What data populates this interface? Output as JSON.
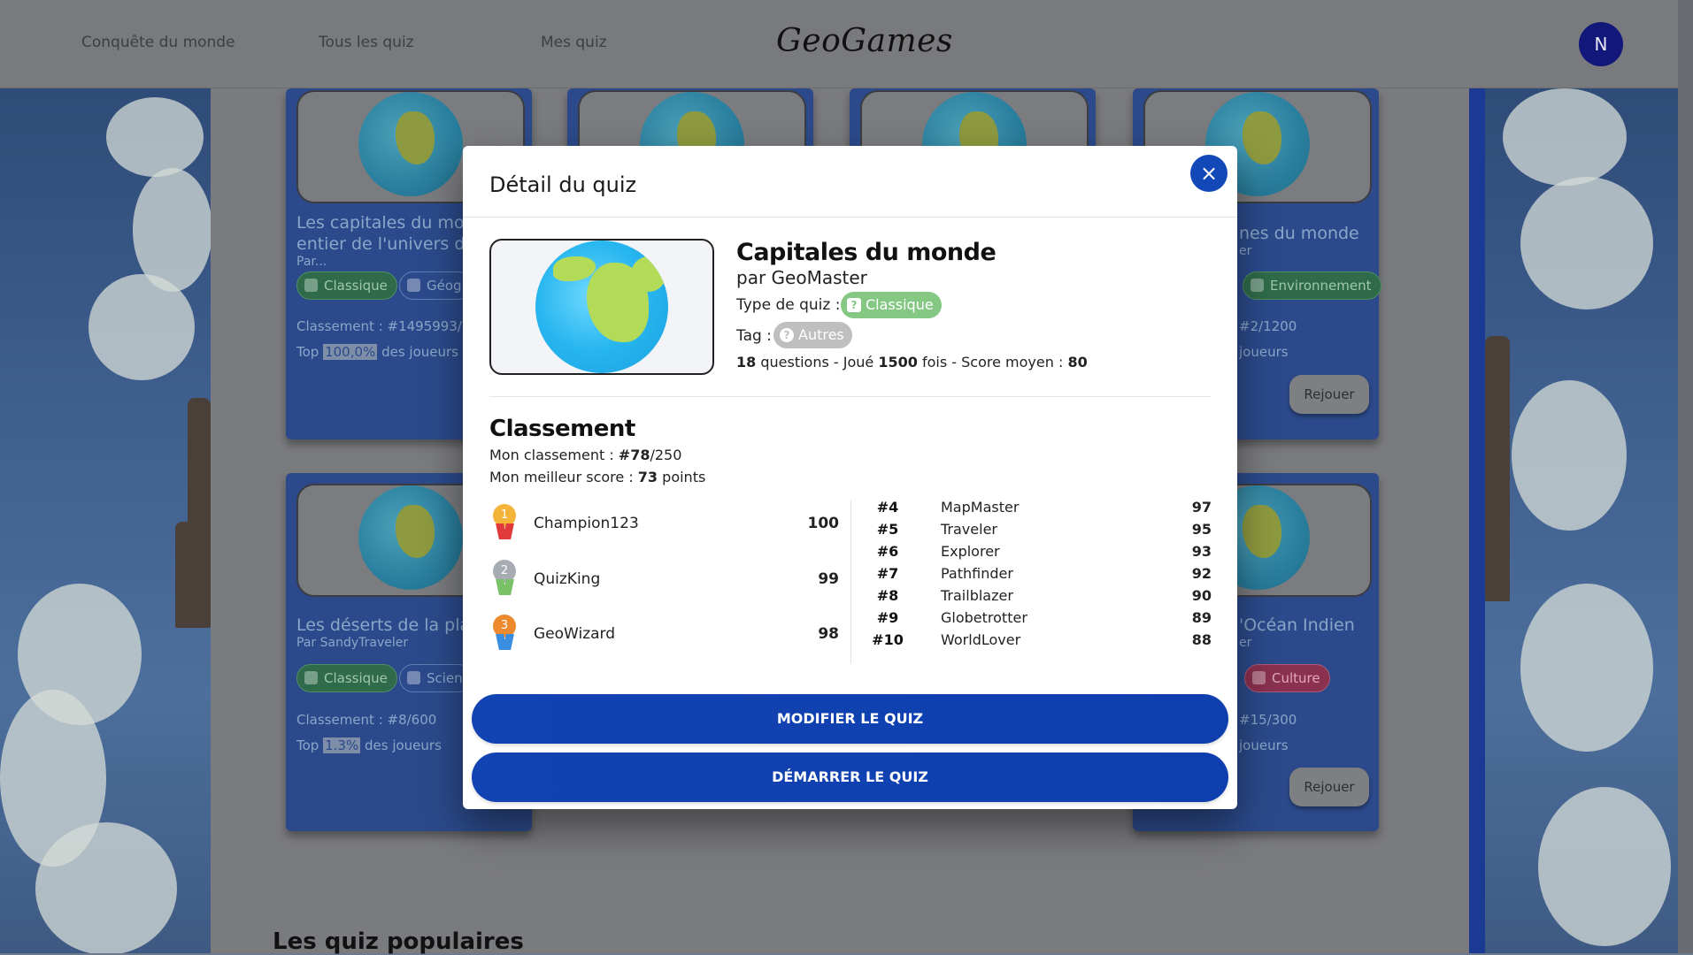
{
  "header": {
    "nav": [
      "Conquête du monde",
      "Tous les quiz",
      "Mes quiz"
    ],
    "logo": "GeoGames",
    "avatar_initial": "N"
  },
  "cards": [
    {
      "title_line1": "Les capitales du mo",
      "title_line2": "entier de l'univers de",
      "author": "Par...",
      "tag1": "Classique",
      "tag2": "Géog",
      "rank": "Classement : #1495993/",
      "top_prefix": "Top",
      "top_value": "100,0%",
      "top_suffix": "des joueurs"
    },
    {
      "title_line1": "nes du monde",
      "author": "er",
      "tag2": "Environnement",
      "rank": "#2/1200",
      "top_suffix": "joueurs",
      "button": "Rejouer"
    },
    {
      "title_line1": "Les déserts de la pla",
      "author": "Par SandyTraveler",
      "tag1": "Classique",
      "tag2": "Scien",
      "rank": "Classement : #8/600",
      "top_prefix": "Top",
      "top_value": "1.3%",
      "top_suffix": "des joueurs"
    },
    {
      "title_line1": "'Océan Indien",
      "author": "er",
      "tag2": "Culture",
      "rank": "#15/300",
      "top_suffix": "joueurs",
      "button": "Rejouer"
    }
  ],
  "section_title": "Les quiz populaires",
  "modal": {
    "title": "Détail du quiz",
    "close_icon": "×",
    "quiz_name": "Capitales du monde",
    "author": "par GeoMaster",
    "type_label": "Type de quiz :",
    "type_value": "Classique",
    "type_icon_glyph": "?",
    "tag_label": "Tag :",
    "tag_value": "Autres",
    "tag_icon_glyph": "?",
    "questions": "18",
    "questions_label": "questions -",
    "played_label": "Joué",
    "played": "1500",
    "played_suffix": "fois - Score moyen :",
    "average": "80",
    "ranking_title": "Classement",
    "my_rank_label": "Mon classement :",
    "my_rank_prefix": "#",
    "my_rank": "78",
    "my_rank_total": "/250",
    "best_label": "Mon meilleur score :",
    "best": "73",
    "best_suffix": "points",
    "podium": [
      {
        "medal": "1",
        "name": "Champion123",
        "score": "100",
        "disc_color": "#f4b43a",
        "ribbon_color": "#e03a3a"
      },
      {
        "medal": "2",
        "name": "QuizKing",
        "score": "99",
        "disc_color": "#a7acb3",
        "ribbon_color": "#7ac268"
      },
      {
        "medal": "3",
        "name": "GeoWizard",
        "score": "98",
        "disc_color": "#ee8a2e",
        "ribbon_color": "#3a8ee0"
      }
    ],
    "others": [
      {
        "rank": "#4",
        "name": "MapMaster",
        "score": "97"
      },
      {
        "rank": "#5",
        "name": "Traveler",
        "score": "95"
      },
      {
        "rank": "#6",
        "name": "Explorer",
        "score": "93"
      },
      {
        "rank": "#7",
        "name": "Pathfinder",
        "score": "92"
      },
      {
        "rank": "#8",
        "name": "Trailblazer",
        "score": "90"
      },
      {
        "rank": "#9",
        "name": "Globetrotter",
        "score": "89"
      },
      {
        "rank": "#10",
        "name": "WorldLover",
        "score": "88"
      }
    ],
    "edit_button": "MODIFIER LE QUIZ",
    "start_button": "DÉMARRER LE QUIZ"
  }
}
